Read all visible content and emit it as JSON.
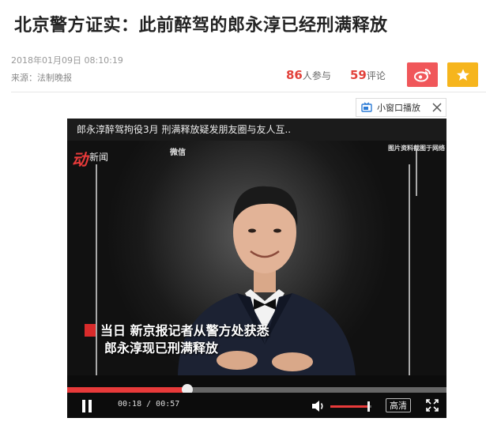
{
  "article": {
    "title": "北京警方证实：此前醉驾的郎永淳已经刑满释放",
    "datetime": "2018年01月09日  08:10:19",
    "source": "来源：法制晚报"
  },
  "stats": {
    "participants_count": "86",
    "participants_label": "人参与",
    "comments_count": "59",
    "comments_label": "评论"
  },
  "share": {
    "weibo_icon": "weibo-icon",
    "favorite_icon": "star-icon",
    "weibo_color": "#f0575a",
    "favorite_color": "#f6b51d"
  },
  "mini_player": {
    "label": "小窗口播放"
  },
  "video": {
    "title": "郎永淳醉驾拘役3月 刑满释放疑发朋友圈与友人互..",
    "logo_mark": "动",
    "logo_text": "新闻",
    "tag_wechat": "微信",
    "tag_source": "图片资料截图于网络",
    "subtitle_line1": "当日 新京报记者从警方处获悉",
    "subtitle_line2": "郎永淳现已刑满释放",
    "current_time": "00:18",
    "duration": "00:57",
    "progress_fraction": 0.316,
    "volume_fraction": 0.92,
    "quality_label": "高清",
    "accent_color": "#e83a3a"
  }
}
